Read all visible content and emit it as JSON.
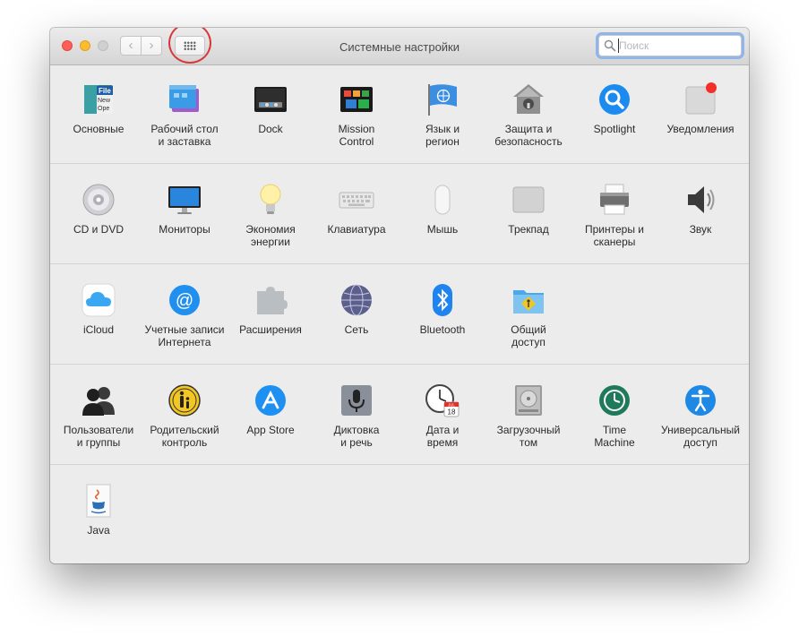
{
  "window": {
    "title": "Системные настройки",
    "nav_back_label": "‹",
    "nav_forward_label": "›"
  },
  "search": {
    "placeholder": "Поиск"
  },
  "sections": [
    [
      {
        "id": "general",
        "label": "Основные",
        "icon": "general-icon"
      },
      {
        "id": "desktop",
        "label": "Рабочий стол\nи заставка",
        "icon": "desktop-screensaver-icon"
      },
      {
        "id": "dock",
        "label": "Dock",
        "icon": "dock-icon"
      },
      {
        "id": "mission",
        "label": "Mission\nControl",
        "icon": "mission-control-icon"
      },
      {
        "id": "language",
        "label": "Язык и\nрегион",
        "icon": "language-region-icon"
      },
      {
        "id": "security",
        "label": "Защита и\nбезопасность",
        "icon": "security-privacy-icon"
      },
      {
        "id": "spotlight",
        "label": "Spotlight",
        "icon": "spotlight-icon"
      },
      {
        "id": "notifications",
        "label": "Уведомления",
        "icon": "notifications-icon"
      }
    ],
    [
      {
        "id": "cddvd",
        "label": "CD и DVD",
        "icon": "cd-dvd-icon"
      },
      {
        "id": "displays",
        "label": "Мониторы",
        "icon": "displays-icon"
      },
      {
        "id": "energy",
        "label": "Экономия\nэнергии",
        "icon": "energy-saver-icon"
      },
      {
        "id": "keyboard",
        "label": "Клавиатура",
        "icon": "keyboard-icon"
      },
      {
        "id": "mouse",
        "label": "Мышь",
        "icon": "mouse-icon"
      },
      {
        "id": "trackpad",
        "label": "Трекпад",
        "icon": "trackpad-icon"
      },
      {
        "id": "printers",
        "label": "Принтеры и\nсканеры",
        "icon": "printer-icon"
      },
      {
        "id": "sound",
        "label": "Звук",
        "icon": "sound-icon"
      }
    ],
    [
      {
        "id": "icloud",
        "label": "iCloud",
        "icon": "icloud-icon"
      },
      {
        "id": "internet",
        "label": "Учетные записи\nИнтернета",
        "icon": "internet-accounts-icon"
      },
      {
        "id": "extensions",
        "label": "Расширения",
        "icon": "extensions-icon"
      },
      {
        "id": "network",
        "label": "Сеть",
        "icon": "network-icon"
      },
      {
        "id": "bluetooth",
        "label": "Bluetooth",
        "icon": "bluetooth-icon"
      },
      {
        "id": "sharing",
        "label": "Общий\nдоступ",
        "icon": "sharing-icon"
      }
    ],
    [
      {
        "id": "users",
        "label": "Пользователи\nи группы",
        "icon": "users-groups-icon"
      },
      {
        "id": "parental",
        "label": "Родительский\nконтроль",
        "icon": "parental-controls-icon"
      },
      {
        "id": "appstore",
        "label": "App Store",
        "icon": "app-store-icon"
      },
      {
        "id": "dictation",
        "label": "Диктовка\nи речь",
        "icon": "dictation-speech-icon"
      },
      {
        "id": "datetime",
        "label": "Дата и\nвремя",
        "icon": "date-time-icon"
      },
      {
        "id": "startup",
        "label": "Загрузочный\nтом",
        "icon": "startup-disk-icon"
      },
      {
        "id": "timemachine",
        "label": "Time\nMachine",
        "icon": "time-machine-icon"
      },
      {
        "id": "accessibility",
        "label": "Универсальный\nдоступ",
        "icon": "accessibility-icon"
      }
    ],
    [
      {
        "id": "java",
        "label": "Java",
        "icon": "java-icon"
      }
    ]
  ],
  "icon_text": {
    "general_file": "File",
    "general_new": "New",
    "general_open": "Ope",
    "calendar_month": "JUL",
    "calendar_day": "18"
  }
}
